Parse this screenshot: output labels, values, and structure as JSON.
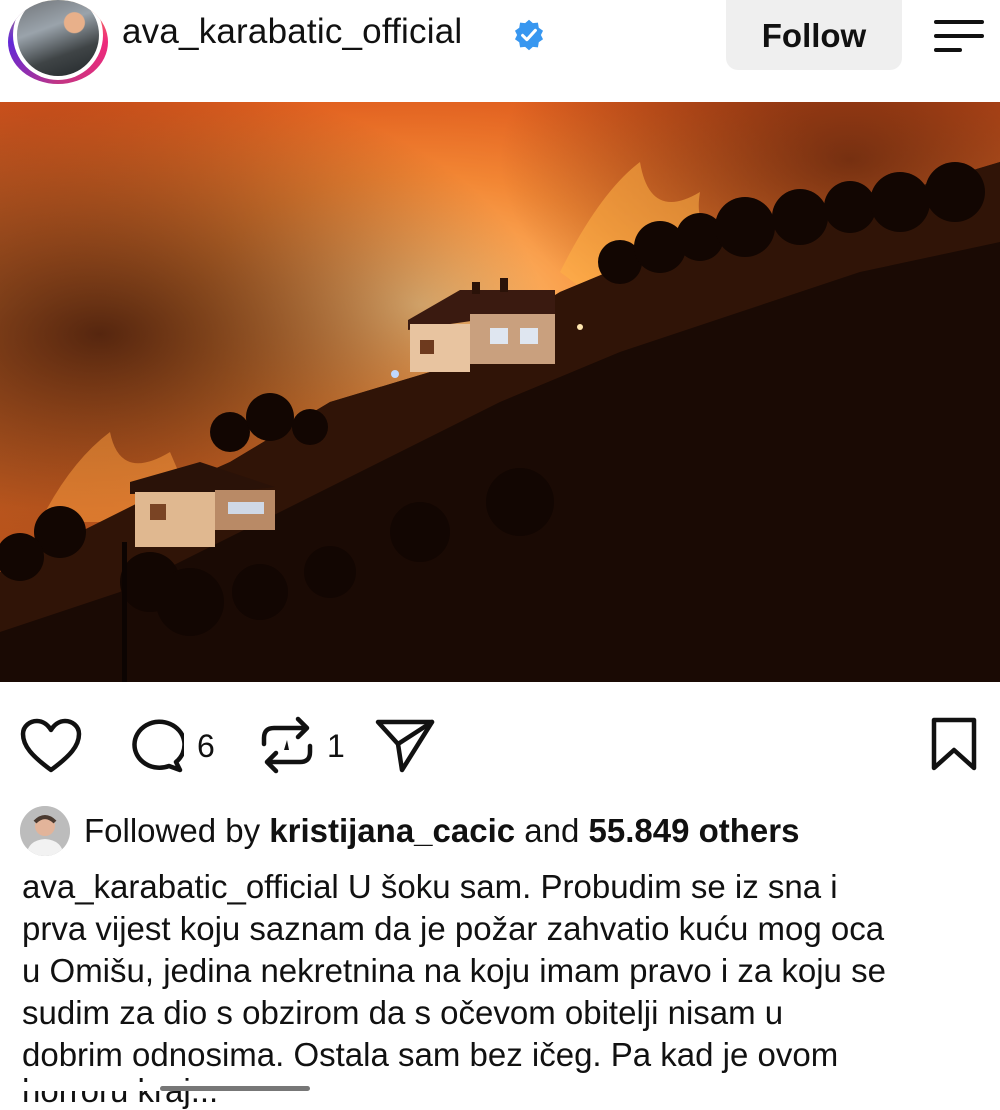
{
  "header": {
    "username": "ava_karabatic_official",
    "follow_label": "Follow",
    "avatar_icon": "profile-avatar",
    "verified_icon": "verified-badge-icon",
    "menu_icon": "menu-icon"
  },
  "post": {
    "image_icon": "post-photo"
  },
  "actions": {
    "like_icon": "heart-icon",
    "comment_icon": "comment-icon",
    "comment_count": "6",
    "repost_icon": "repost-icon",
    "repost_count": "1",
    "share_icon": "send-icon",
    "save_icon": "bookmark-icon"
  },
  "social": {
    "followed_prefix": "Followed by",
    "followed_user": "kristijana_cacic",
    "followed_and": "and",
    "followed_others": "55.849 others"
  },
  "caption": {
    "username": "ava_karabatic_official",
    "lines": [
      " U šoku sam. Probudim se iz sna i",
      "prva vijest koju saznam da je požar zahvatio kuću mog oca",
      "u Omišu, jedina nekretnina na koju imam pravo i za koju se",
      "sudim  za dio s obzirom da s očevom obitelji nisam u",
      "dobrim odnosima. Ostala sam  bez ičeg. Pa kad je ovom",
      "horroru kraj..."
    ]
  },
  "colors": {
    "accent": "#3897f0",
    "follow_bg": "#efefef",
    "text": "#111111"
  }
}
